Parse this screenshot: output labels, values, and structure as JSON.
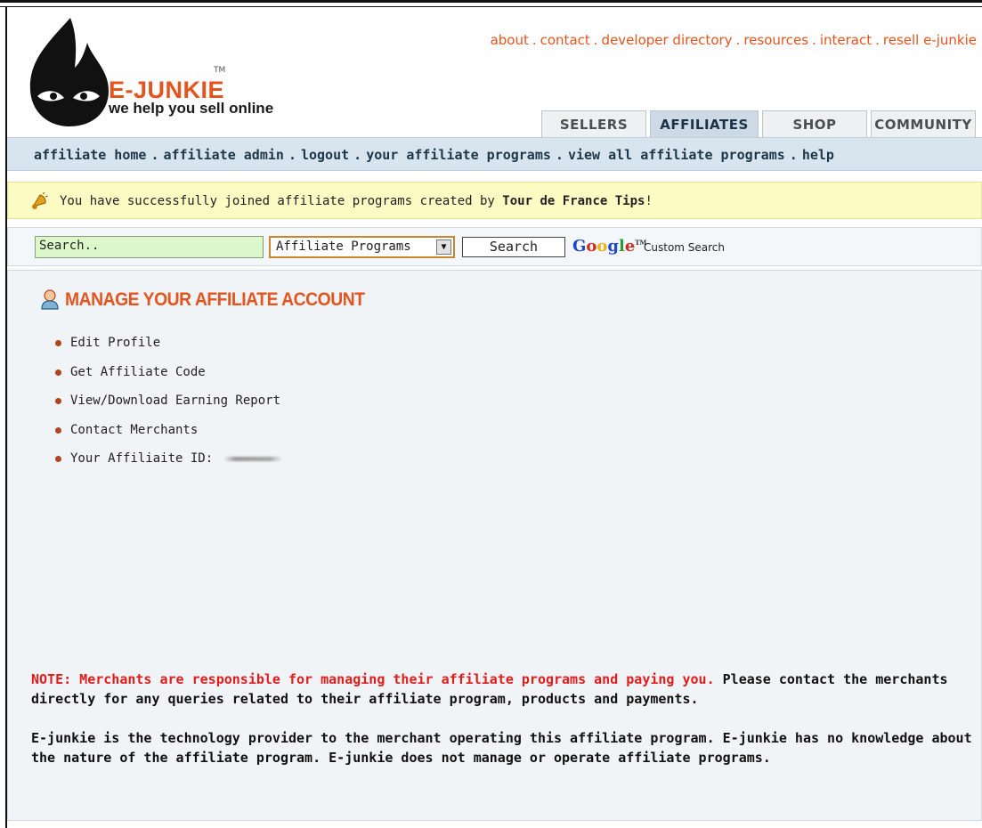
{
  "header": {
    "brand": "E-JUNKIE",
    "trademark": "TM",
    "tagline": "we help you sell online",
    "top_links": [
      {
        "label": "about"
      },
      {
        "label": "contact"
      },
      {
        "label": "developer directory"
      },
      {
        "label": "resources"
      },
      {
        "label": "interact"
      },
      {
        "label": "resell e-junkie"
      }
    ],
    "link_separator": ".",
    "tabs": [
      {
        "label": "SELLERS",
        "active": false
      },
      {
        "label": "AFFILIATES",
        "active": true
      },
      {
        "label": "SHOP",
        "active": false
      },
      {
        "label": "COMMUNITY",
        "active": false
      }
    ]
  },
  "nav": {
    "items": [
      {
        "label": "affiliate home"
      },
      {
        "label": "affiliate admin"
      },
      {
        "label": "logout"
      },
      {
        "label": "your affiliate programs"
      },
      {
        "label": "view all affiliate programs"
      },
      {
        "label": "help"
      }
    ],
    "separator": "."
  },
  "notice": {
    "text_before": "You have successfully joined affiliate programs created by ",
    "merchant": "Tour de France Tips",
    "text_after": "!",
    "icon": "bell-icon"
  },
  "search": {
    "input_value": "Search..",
    "select_value": "Affiliate Programs",
    "button_label": "Search",
    "powered_by": "Google",
    "powered_by_tm": "TM",
    "custom_label": "Custom Search"
  },
  "main": {
    "title": "MANAGE YOUR AFFILIATE ACCOUNT",
    "title_icon": "user-icon",
    "menu": [
      {
        "label": "Edit Profile"
      },
      {
        "label": "Get Affiliate Code"
      },
      {
        "label": "View/Download Earning Report"
      },
      {
        "label": "Contact Merchants"
      }
    ],
    "affiliate_id_label": "Your Affiliaite ID:",
    "note_red": "NOTE: Merchants are responsible for managing their affiliate programs and paying you.",
    "note_rest": " Please contact the merchants directly for any queries related to their affiliate program, products and payments.",
    "disclaimer": "E-junkie is the technology provider to the merchant operating this affiliate program. E-junkie has no knowledge about the nature of the affiliate program.  E-junkie does not manage or operate affiliate programs."
  },
  "colors": {
    "brand_orange": "#e4541e",
    "nav_bg": "#d8e5ee",
    "notice_bg": "#fcfbc4",
    "main_bg": "#f0f4f7",
    "note_red": "#e21b1b"
  }
}
